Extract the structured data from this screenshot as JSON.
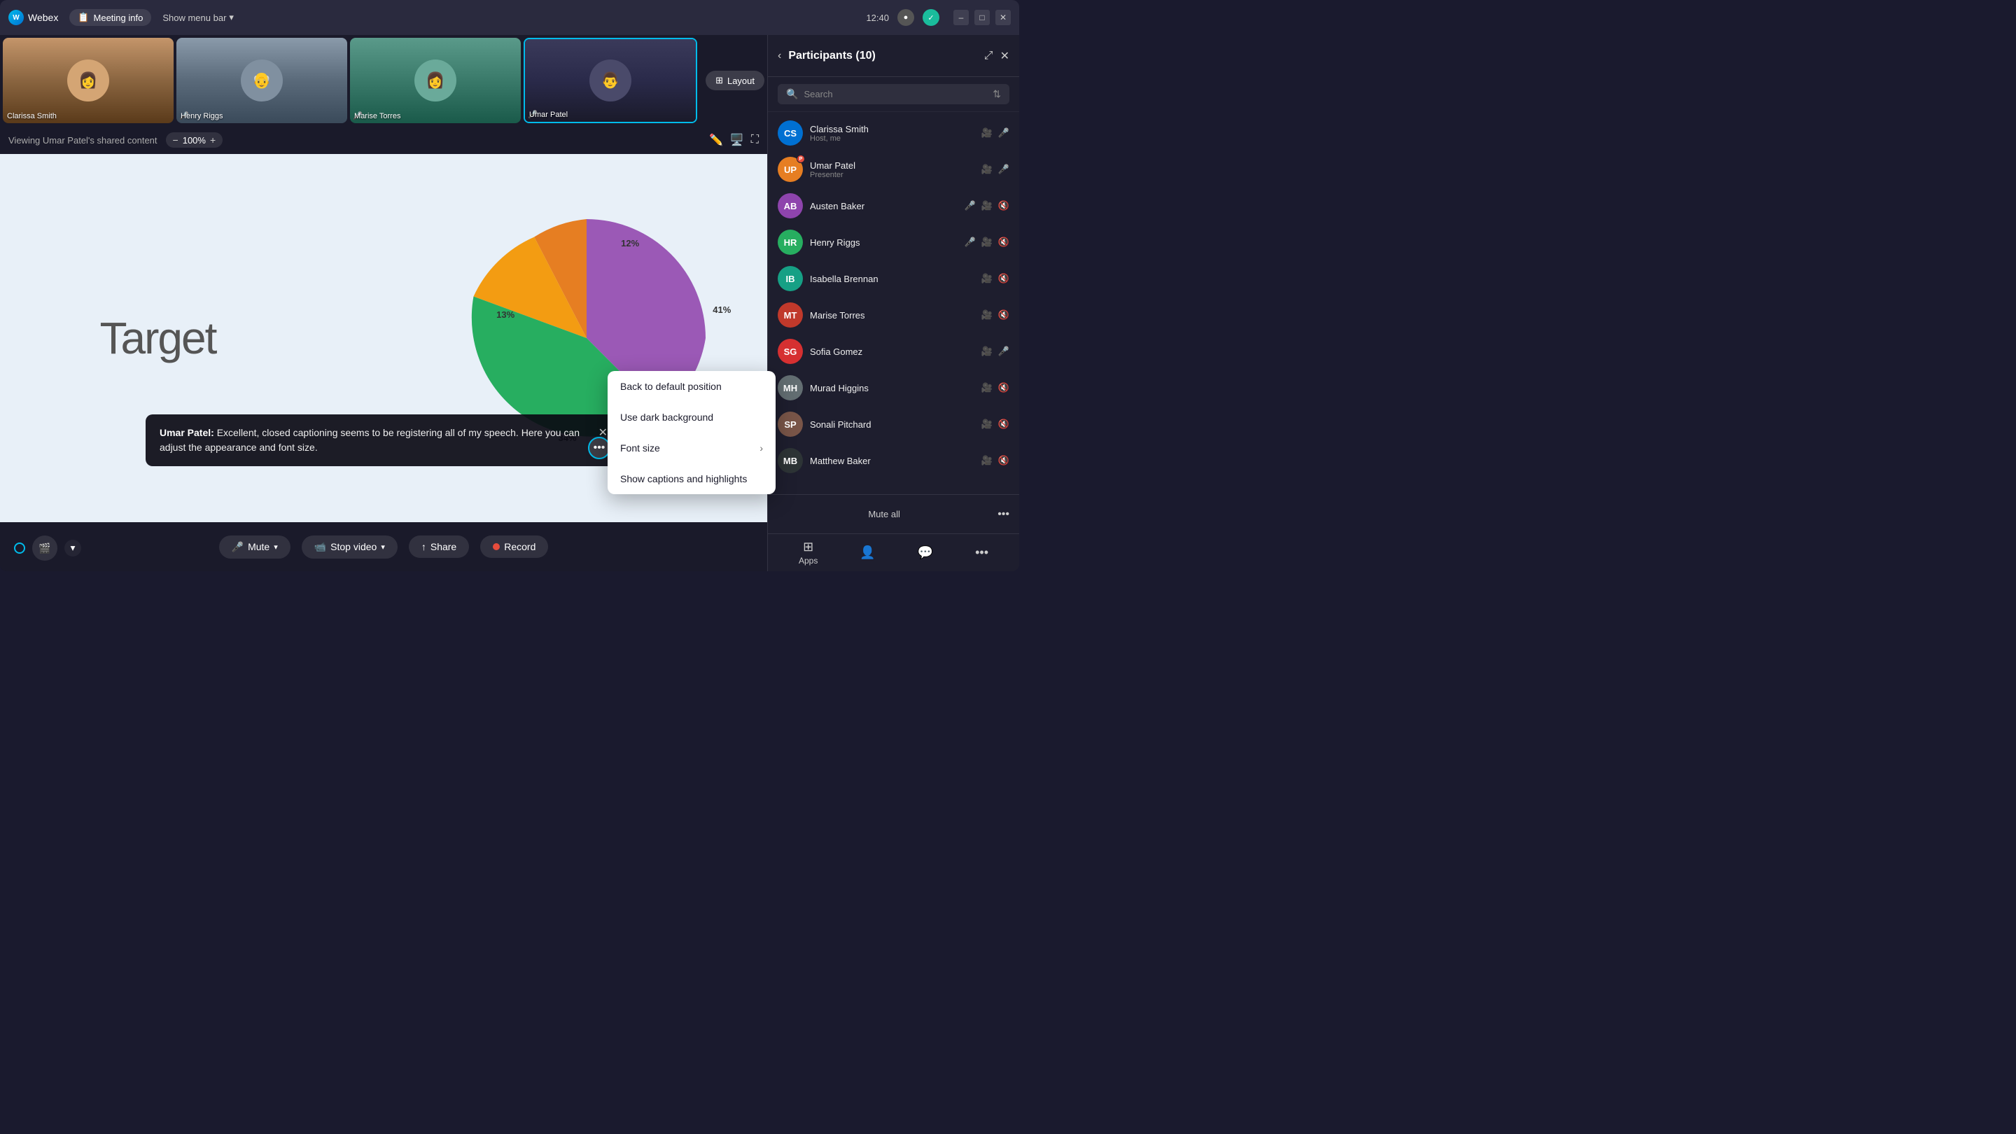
{
  "titlebar": {
    "app_name": "Webex",
    "meeting_info_label": "Meeting info",
    "show_menu_label": "Show menu bar",
    "time": "12:40",
    "minimize_label": "–",
    "maximize_label": "□",
    "close_label": "✕"
  },
  "thumbnails": [
    {
      "id": "clarissa",
      "name": "Clarissa Smith",
      "bg": "clarissa",
      "active": false
    },
    {
      "id": "henry",
      "name": "Henry Riggs",
      "bg": "henry",
      "active": false
    },
    {
      "id": "marise",
      "name": "Marise Torres",
      "bg": "marise",
      "active": false
    },
    {
      "id": "umar",
      "name": "Umar Patel",
      "bg": "umar",
      "active": true
    }
  ],
  "content_area": {
    "viewing_label": "Viewing Umar Patel's shared content",
    "zoom_value": "100%",
    "zoom_minus": "−",
    "zoom_plus": "+"
  },
  "slide": {
    "target_text": "Target",
    "pie_segments": [
      {
        "label": "41%",
        "color": "#9b59b6",
        "class": "p41"
      },
      {
        "label": "12%",
        "color": "#e67e22",
        "class": "p12"
      },
      {
        "label": "13%",
        "color": "#f39c12",
        "class": "p13"
      },
      {
        "label": "34%",
        "color": "#27ae60",
        "class": "p34"
      }
    ]
  },
  "caption": {
    "speaker": "Umar Patel:",
    "text": "Excellent, closed captioning seems to be registering all of my speech. Here you can adjust the appearance and font size."
  },
  "context_menu": {
    "items": [
      {
        "label": "Back to default position",
        "has_arrow": false
      },
      {
        "label": "Use dark background",
        "has_arrow": false
      },
      {
        "label": "Font size",
        "has_arrow": true
      },
      {
        "label": "Show captions and highlights",
        "has_arrow": false
      }
    ]
  },
  "toolbar": {
    "mute_label": "Mute",
    "stop_video_label": "Stop video",
    "share_label": "Share",
    "record_label": "Record"
  },
  "participants_panel": {
    "title": "Participants (10)",
    "search_placeholder": "Search",
    "participants": [
      {
        "id": "clarissa",
        "name": "Clarissa Smith",
        "role": "Host, me",
        "av_class": "av-blue",
        "initials": "CS",
        "cam": true,
        "mic_muted": false
      },
      {
        "id": "umar",
        "name": "Umar Patel",
        "role": "Presenter",
        "av_class": "av-orange",
        "initials": "UP",
        "cam": true,
        "mic_muted": false,
        "presenter": true
      },
      {
        "id": "austen",
        "name": "Austen Baker",
        "role": "",
        "av_class": "av-purple",
        "initials": "AB",
        "cam": true,
        "mic_muted": true
      },
      {
        "id": "henry",
        "name": "Henry Riggs",
        "role": "",
        "av_class": "av-green",
        "initials": "HR",
        "cam": true,
        "mic_muted": true
      },
      {
        "id": "isabella",
        "name": "Isabella Brennan",
        "role": "",
        "av_class": "av-teal",
        "initials": "IB",
        "cam": true,
        "mic_muted": true
      },
      {
        "id": "marise",
        "name": "Marise Torres",
        "role": "",
        "av_class": "av-red",
        "initials": "MT",
        "cam": true,
        "mic_muted": true
      },
      {
        "id": "sofia",
        "name": "Sofia Gomez",
        "role": "",
        "av_class": "av-pink",
        "initials": "SG",
        "cam": true,
        "mic_muted": false
      },
      {
        "id": "murad",
        "name": "Murad Higgins",
        "role": "",
        "av_class": "av-grey",
        "initials": "MH",
        "cam": true,
        "mic_muted": true
      },
      {
        "id": "sonali",
        "name": "Sonali Pitchard",
        "role": "",
        "av_class": "av-brown",
        "initials": "SP",
        "cam": true,
        "mic_muted": true
      },
      {
        "id": "matthew",
        "name": "Matthew Baker",
        "role": "",
        "av_class": "av-dark",
        "initials": "MB",
        "cam": true,
        "mic_muted": true
      }
    ],
    "mute_all_label": "Mute all",
    "apps_label": "Apps",
    "people_icon": "👤",
    "chat_icon": "💬"
  }
}
